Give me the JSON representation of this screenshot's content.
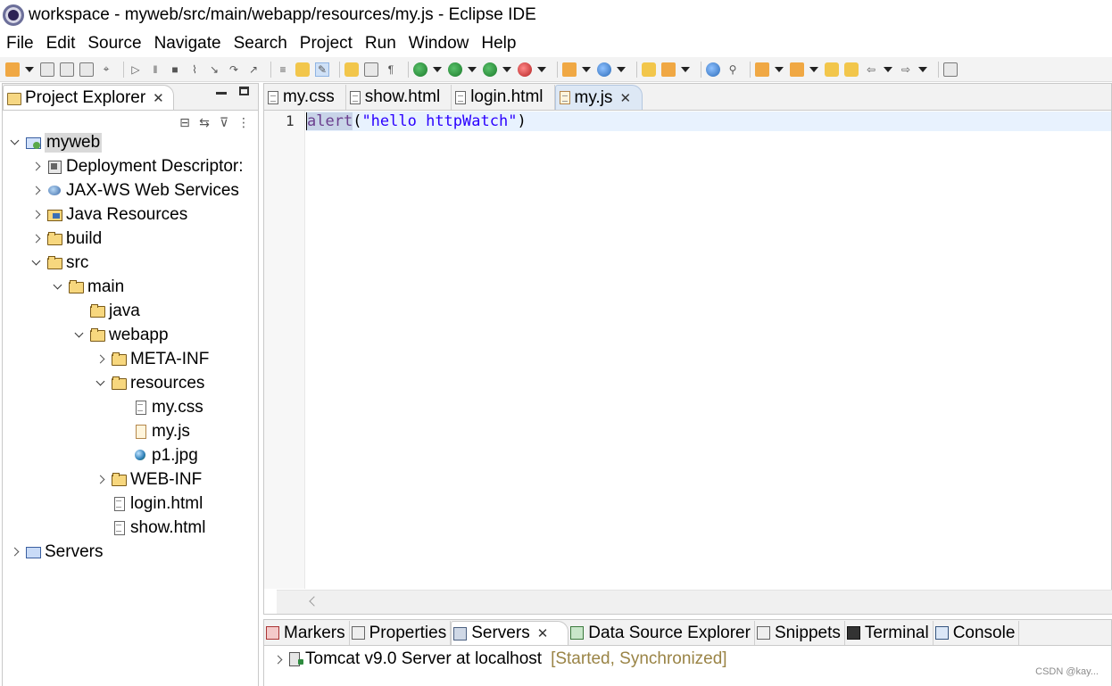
{
  "window": {
    "title": "workspace - myweb/src/main/webapp/resources/my.js - Eclipse IDE"
  },
  "menu": [
    "File",
    "Edit",
    "Source",
    "Navigate",
    "Search",
    "Project",
    "Run",
    "Window",
    "Help"
  ],
  "explorer": {
    "tab_label": "Project Explorer",
    "tree": [
      {
        "label": "myweb",
        "icon": "project-icon",
        "expanded": true,
        "selected": true
      },
      {
        "label": "Deployment Descriptor:",
        "icon": "deployment-descriptor-icon"
      },
      {
        "label": "JAX-WS Web Services",
        "icon": "web-services-icon"
      },
      {
        "label": "Java Resources",
        "icon": "java-resources-icon"
      },
      {
        "label": "build",
        "icon": "folder-icon"
      },
      {
        "label": "src",
        "icon": "folder-icon",
        "expanded": true
      },
      {
        "label": "main",
        "icon": "folder-icon",
        "expanded": true
      },
      {
        "label": "java",
        "icon": "folder-icon"
      },
      {
        "label": "webapp",
        "icon": "folder-icon",
        "expanded": true
      },
      {
        "label": "META-INF",
        "icon": "folder-icon"
      },
      {
        "label": "resources",
        "icon": "folder-icon",
        "expanded": true
      },
      {
        "label": "my.css",
        "icon": "file-icon"
      },
      {
        "label": "my.js",
        "icon": "js-file-icon"
      },
      {
        "label": "p1.jpg",
        "icon": "image-file-icon"
      },
      {
        "label": "WEB-INF",
        "icon": "folder-icon"
      },
      {
        "label": "login.html",
        "icon": "file-icon"
      },
      {
        "label": "show.html",
        "icon": "file-icon"
      },
      {
        "label": "Servers",
        "icon": "servers-project-icon"
      }
    ]
  },
  "editor": {
    "tabs": [
      {
        "label": "my.css"
      },
      {
        "label": "show.html"
      },
      {
        "label": "login.html"
      },
      {
        "label": "my.js",
        "active": true
      }
    ],
    "line_number": "1",
    "code": {
      "keyword": "alert",
      "open": "(",
      "string": "\"hello httpWatch\"",
      "close": ")"
    }
  },
  "bottom_panel": {
    "tabs": [
      {
        "label": "Markers"
      },
      {
        "label": "Properties"
      },
      {
        "label": "Servers",
        "active": true
      },
      {
        "label": "Data Source Explorer"
      },
      {
        "label": "Snippets"
      },
      {
        "label": "Terminal"
      },
      {
        "label": "Console"
      }
    ],
    "server": {
      "name": "Tomcat v9.0 Server at localhost",
      "status": "[Started, Synchronized]"
    }
  },
  "watermark": "CSDN @kay..."
}
